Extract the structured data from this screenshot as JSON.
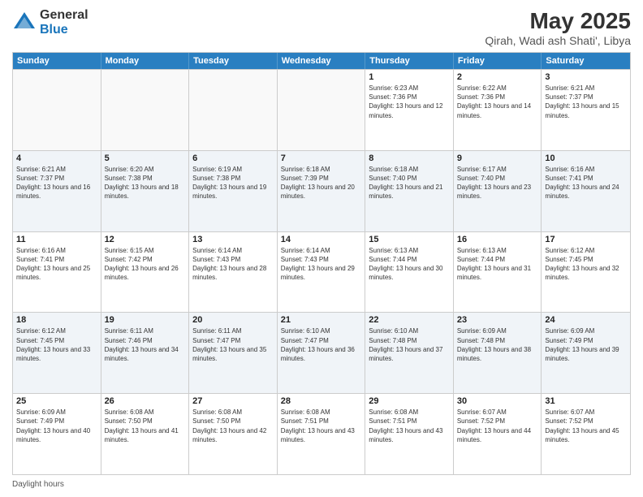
{
  "logo": {
    "general": "General",
    "blue": "Blue"
  },
  "title": "May 2025",
  "subtitle": "Qirah, Wadi ash Shati', Libya",
  "footer_note": "Daylight hours",
  "days_of_week": [
    "Sunday",
    "Monday",
    "Tuesday",
    "Wednesday",
    "Thursday",
    "Friday",
    "Saturday"
  ],
  "weeks": [
    [
      {
        "day": "",
        "sunrise": "",
        "sunset": "",
        "daylight": "",
        "empty": true
      },
      {
        "day": "",
        "sunrise": "",
        "sunset": "",
        "daylight": "",
        "empty": true
      },
      {
        "day": "",
        "sunrise": "",
        "sunset": "",
        "daylight": "",
        "empty": true
      },
      {
        "day": "",
        "sunrise": "",
        "sunset": "",
        "daylight": "",
        "empty": true
      },
      {
        "day": "1",
        "sunrise": "6:23 AM",
        "sunset": "7:36 PM",
        "daylight": "13 hours and 12 minutes."
      },
      {
        "day": "2",
        "sunrise": "6:22 AM",
        "sunset": "7:36 PM",
        "daylight": "13 hours and 14 minutes."
      },
      {
        "day": "3",
        "sunrise": "6:21 AM",
        "sunset": "7:37 PM",
        "daylight": "13 hours and 15 minutes."
      }
    ],
    [
      {
        "day": "4",
        "sunrise": "6:21 AM",
        "sunset": "7:37 PM",
        "daylight": "13 hours and 16 minutes."
      },
      {
        "day": "5",
        "sunrise": "6:20 AM",
        "sunset": "7:38 PM",
        "daylight": "13 hours and 18 minutes."
      },
      {
        "day": "6",
        "sunrise": "6:19 AM",
        "sunset": "7:38 PM",
        "daylight": "13 hours and 19 minutes."
      },
      {
        "day": "7",
        "sunrise": "6:18 AM",
        "sunset": "7:39 PM",
        "daylight": "13 hours and 20 minutes."
      },
      {
        "day": "8",
        "sunrise": "6:18 AM",
        "sunset": "7:40 PM",
        "daylight": "13 hours and 21 minutes."
      },
      {
        "day": "9",
        "sunrise": "6:17 AM",
        "sunset": "7:40 PM",
        "daylight": "13 hours and 23 minutes."
      },
      {
        "day": "10",
        "sunrise": "6:16 AM",
        "sunset": "7:41 PM",
        "daylight": "13 hours and 24 minutes."
      }
    ],
    [
      {
        "day": "11",
        "sunrise": "6:16 AM",
        "sunset": "7:41 PM",
        "daylight": "13 hours and 25 minutes."
      },
      {
        "day": "12",
        "sunrise": "6:15 AM",
        "sunset": "7:42 PM",
        "daylight": "13 hours and 26 minutes."
      },
      {
        "day": "13",
        "sunrise": "6:14 AM",
        "sunset": "7:43 PM",
        "daylight": "13 hours and 28 minutes."
      },
      {
        "day": "14",
        "sunrise": "6:14 AM",
        "sunset": "7:43 PM",
        "daylight": "13 hours and 29 minutes."
      },
      {
        "day": "15",
        "sunrise": "6:13 AM",
        "sunset": "7:44 PM",
        "daylight": "13 hours and 30 minutes."
      },
      {
        "day": "16",
        "sunrise": "6:13 AM",
        "sunset": "7:44 PM",
        "daylight": "13 hours and 31 minutes."
      },
      {
        "day": "17",
        "sunrise": "6:12 AM",
        "sunset": "7:45 PM",
        "daylight": "13 hours and 32 minutes."
      }
    ],
    [
      {
        "day": "18",
        "sunrise": "6:12 AM",
        "sunset": "7:45 PM",
        "daylight": "13 hours and 33 minutes."
      },
      {
        "day": "19",
        "sunrise": "6:11 AM",
        "sunset": "7:46 PM",
        "daylight": "13 hours and 34 minutes."
      },
      {
        "day": "20",
        "sunrise": "6:11 AM",
        "sunset": "7:47 PM",
        "daylight": "13 hours and 35 minutes."
      },
      {
        "day": "21",
        "sunrise": "6:10 AM",
        "sunset": "7:47 PM",
        "daylight": "13 hours and 36 minutes."
      },
      {
        "day": "22",
        "sunrise": "6:10 AM",
        "sunset": "7:48 PM",
        "daylight": "13 hours and 37 minutes."
      },
      {
        "day": "23",
        "sunrise": "6:09 AM",
        "sunset": "7:48 PM",
        "daylight": "13 hours and 38 minutes."
      },
      {
        "day": "24",
        "sunrise": "6:09 AM",
        "sunset": "7:49 PM",
        "daylight": "13 hours and 39 minutes."
      }
    ],
    [
      {
        "day": "25",
        "sunrise": "6:09 AM",
        "sunset": "7:49 PM",
        "daylight": "13 hours and 40 minutes."
      },
      {
        "day": "26",
        "sunrise": "6:08 AM",
        "sunset": "7:50 PM",
        "daylight": "13 hours and 41 minutes."
      },
      {
        "day": "27",
        "sunrise": "6:08 AM",
        "sunset": "7:50 PM",
        "daylight": "13 hours and 42 minutes."
      },
      {
        "day": "28",
        "sunrise": "6:08 AM",
        "sunset": "7:51 PM",
        "daylight": "13 hours and 43 minutes."
      },
      {
        "day": "29",
        "sunrise": "6:08 AM",
        "sunset": "7:51 PM",
        "daylight": "13 hours and 43 minutes."
      },
      {
        "day": "30",
        "sunrise": "6:07 AM",
        "sunset": "7:52 PM",
        "daylight": "13 hours and 44 minutes."
      },
      {
        "day": "31",
        "sunrise": "6:07 AM",
        "sunset": "7:52 PM",
        "daylight": "13 hours and 45 minutes."
      }
    ]
  ]
}
